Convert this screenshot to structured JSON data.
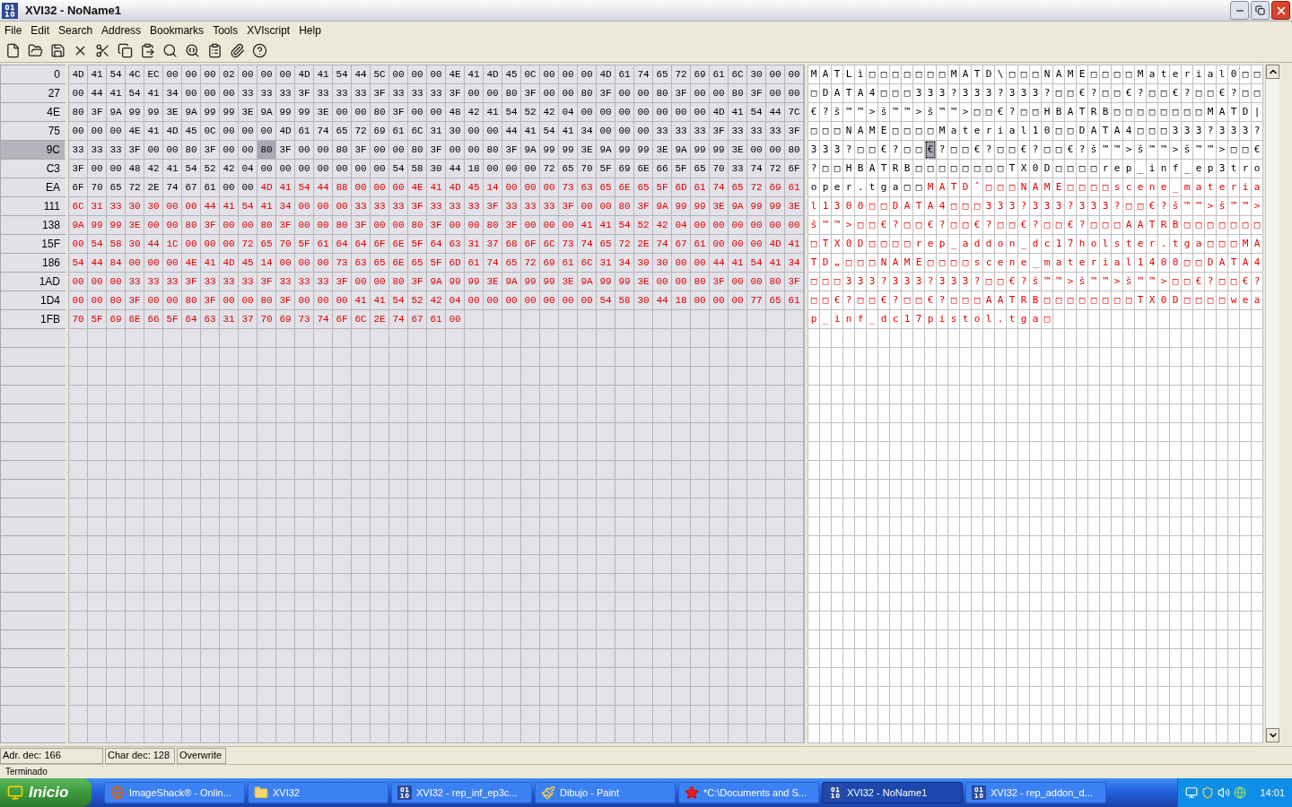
{
  "window": {
    "title": "XVI32 - NoName1"
  },
  "menu": [
    "File",
    "Edit",
    "Search",
    "Address",
    "Bookmarks",
    "Tools",
    "XVIscript",
    "Help"
  ],
  "rows": [
    {
      "address": "0",
      "selected": false,
      "hex": [
        "4D",
        "41",
        "54",
        "4C",
        "EC",
        "00",
        "00",
        "00",
        "02",
        "00",
        "00",
        "00",
        "4D",
        "41",
        "54",
        "44",
        "5C",
        "00",
        "00",
        "00",
        "4E",
        "41",
        "4D",
        "45",
        "0C",
        "00",
        "00",
        "00",
        "4D",
        "61",
        "74",
        "65",
        "72",
        "69",
        "61",
        "6C",
        "30",
        "00",
        "00"
      ],
      "chars": [
        "M",
        "A",
        "T",
        "L",
        "ì",
        "□",
        "□",
        "□",
        "□",
        "□",
        "□",
        "□",
        "M",
        "A",
        "T",
        "D",
        "\\",
        "□",
        "□",
        "□",
        "N",
        "A",
        "M",
        "E",
        "□",
        "□",
        "□",
        "□",
        "M",
        "a",
        "t",
        "e",
        "r",
        "i",
        "a",
        "l",
        "0",
        "□",
        "□"
      ],
      "modified": [
        false,
        false,
        false,
        false,
        false,
        false,
        false,
        false,
        false,
        false,
        false,
        false,
        false,
        false,
        false,
        false,
        false,
        false,
        false,
        false,
        false,
        false,
        false,
        false,
        false,
        false,
        false,
        false,
        false,
        false,
        false,
        false,
        false,
        false,
        false,
        false,
        false,
        false,
        false
      ],
      "cursor": [
        false,
        false,
        false,
        false,
        false,
        false,
        false,
        false,
        false,
        false,
        false,
        false,
        false,
        false,
        false,
        false,
        false,
        false,
        false,
        false,
        false,
        false,
        false,
        false,
        false,
        false,
        false,
        false,
        false,
        false,
        false,
        false,
        false,
        false,
        false,
        false,
        false,
        false,
        false
      ]
    },
    {
      "address": "27",
      "selected": false,
      "hex": [
        "00",
        "44",
        "41",
        "54",
        "41",
        "34",
        "00",
        "00",
        "00",
        "33",
        "33",
        "33",
        "3F",
        "33",
        "33",
        "33",
        "3F",
        "33",
        "33",
        "33",
        "3F",
        "00",
        "00",
        "80",
        "3F",
        "00",
        "00",
        "80",
        "3F",
        "00",
        "00",
        "80",
        "3F",
        "00",
        "00",
        "80",
        "3F",
        "00",
        "00"
      ],
      "chars": [
        "□",
        "D",
        "A",
        "T",
        "A",
        "4",
        "□",
        "□",
        "□",
        "3",
        "3",
        "3",
        "?",
        "3",
        "3",
        "3",
        "?",
        "3",
        "3",
        "3",
        "?",
        "□",
        "□",
        "€",
        "?",
        "□",
        "□",
        "€",
        "?",
        "□",
        "□",
        "€",
        "?",
        "□",
        "□",
        "€",
        "?",
        "□",
        "□"
      ],
      "modified": [
        false,
        false,
        false,
        false,
        false,
        false,
        false,
        false,
        false,
        false,
        false,
        false,
        false,
        false,
        false,
        false,
        false,
        false,
        false,
        false,
        false,
        false,
        false,
        false,
        false,
        false,
        false,
        false,
        false,
        false,
        false,
        false,
        false,
        false,
        false,
        false,
        false,
        false,
        false
      ],
      "cursor": [
        false,
        false,
        false,
        false,
        false,
        false,
        false,
        false,
        false,
        false,
        false,
        false,
        false,
        false,
        false,
        false,
        false,
        false,
        false,
        false,
        false,
        false,
        false,
        false,
        false,
        false,
        false,
        false,
        false,
        false,
        false,
        false,
        false,
        false,
        false,
        false,
        false,
        false,
        false
      ]
    },
    {
      "address": "4E",
      "selected": false,
      "hex": [
        "80",
        "3F",
        "9A",
        "99",
        "99",
        "3E",
        "9A",
        "99",
        "99",
        "3E",
        "9A",
        "99",
        "99",
        "3E",
        "00",
        "00",
        "80",
        "3F",
        "00",
        "00",
        "48",
        "42",
        "41",
        "54",
        "52",
        "42",
        "04",
        "00",
        "00",
        "00",
        "00",
        "00",
        "00",
        "00",
        "4D",
        "41",
        "54",
        "44",
        "7C"
      ],
      "chars": [
        "€",
        "?",
        "š",
        "™",
        "™",
        ">",
        "š",
        "™",
        "™",
        ">",
        "š",
        "™",
        "™",
        ">",
        "□",
        "□",
        "€",
        "?",
        "□",
        "□",
        "H",
        "B",
        "A",
        "T",
        "R",
        "B",
        "□",
        "□",
        "□",
        "□",
        "□",
        "□",
        "□",
        "□",
        "M",
        "A",
        "T",
        "D",
        "|"
      ],
      "modified": [
        false,
        false,
        false,
        false,
        false,
        false,
        false,
        false,
        false,
        false,
        false,
        false,
        false,
        false,
        false,
        false,
        false,
        false,
        false,
        false,
        false,
        false,
        false,
        false,
        false,
        false,
        false,
        false,
        false,
        false,
        false,
        false,
        false,
        false,
        false,
        false,
        false,
        false,
        false
      ],
      "cursor": [
        false,
        false,
        false,
        false,
        false,
        false,
        false,
        false,
        false,
        false,
        false,
        false,
        false,
        false,
        false,
        false,
        false,
        false,
        false,
        false,
        false,
        false,
        false,
        false,
        false,
        false,
        false,
        false,
        false,
        false,
        false,
        false,
        false,
        false,
        false,
        false,
        false,
        false,
        false
      ]
    },
    {
      "address": "75",
      "selected": false,
      "hex": [
        "00",
        "00",
        "00",
        "4E",
        "41",
        "4D",
        "45",
        "0C",
        "00",
        "00",
        "00",
        "4D",
        "61",
        "74",
        "65",
        "72",
        "69",
        "61",
        "6C",
        "31",
        "30",
        "00",
        "00",
        "44",
        "41",
        "54",
        "41",
        "34",
        "00",
        "00",
        "00",
        "33",
        "33",
        "33",
        "3F",
        "33",
        "33",
        "33",
        "3F"
      ],
      "chars": [
        "□",
        "□",
        "□",
        "N",
        "A",
        "M",
        "E",
        "□",
        "□",
        "□",
        "□",
        "M",
        "a",
        "t",
        "e",
        "r",
        "i",
        "a",
        "l",
        "1",
        "0",
        "□",
        "□",
        "D",
        "A",
        "T",
        "A",
        "4",
        "□",
        "□",
        "□",
        "3",
        "3",
        "3",
        "?",
        "3",
        "3",
        "3",
        "?"
      ],
      "modified": [
        false,
        false,
        false,
        false,
        false,
        false,
        false,
        false,
        false,
        false,
        false,
        false,
        false,
        false,
        false,
        false,
        false,
        false,
        false,
        false,
        false,
        false,
        false,
        false,
        false,
        false,
        false,
        false,
        false,
        false,
        false,
        false,
        false,
        false,
        false,
        false,
        false,
        false,
        false
      ],
      "cursor": [
        false,
        false,
        false,
        false,
        false,
        false,
        false,
        false,
        false,
        false,
        false,
        false,
        false,
        false,
        false,
        false,
        false,
        false,
        false,
        false,
        false,
        false,
        false,
        false,
        false,
        false,
        false,
        false,
        false,
        false,
        false,
        false,
        false,
        false,
        false,
        false,
        false,
        false,
        false
      ]
    },
    {
      "address": "9C",
      "selected": true,
      "hex": [
        "33",
        "33",
        "33",
        "3F",
        "00",
        "00",
        "80",
        "3F",
        "00",
        "00",
        "80",
        "3F",
        "00",
        "00",
        "80",
        "3F",
        "00",
        "00",
        "80",
        "3F",
        "00",
        "00",
        "80",
        "3F",
        "9A",
        "99",
        "99",
        "3E",
        "9A",
        "99",
        "99",
        "3E",
        "9A",
        "99",
        "99",
        "3E",
        "00",
        "00",
        "80"
      ],
      "chars": [
        "3",
        "3",
        "3",
        "?",
        "□",
        "□",
        "€",
        "?",
        "□",
        "□",
        "€",
        "?",
        "□",
        "□",
        "€",
        "?",
        "□",
        "□",
        "€",
        "?",
        "□",
        "□",
        "€",
        "?",
        "š",
        "™",
        "™",
        ">",
        "š",
        "™",
        "™",
        ">",
        "š",
        "™",
        "™",
        ">",
        "□",
        "□",
        "€"
      ],
      "modified": [
        false,
        false,
        false,
        false,
        false,
        false,
        false,
        false,
        false,
        false,
        false,
        false,
        false,
        false,
        false,
        false,
        false,
        false,
        false,
        false,
        false,
        false,
        false,
        false,
        false,
        false,
        false,
        false,
        false,
        false,
        false,
        false,
        false,
        false,
        false,
        false,
        false,
        false,
        false
      ],
      "cursor": [
        false,
        false,
        false,
        false,
        false,
        false,
        false,
        false,
        false,
        false,
        true,
        false,
        false,
        false,
        false,
        false,
        false,
        false,
        false,
        false,
        false,
        false,
        false,
        false,
        false,
        false,
        false,
        false,
        false,
        false,
        false,
        false,
        false,
        false,
        false,
        false,
        false,
        false,
        false
      ]
    },
    {
      "address": "C3",
      "selected": false,
      "hex": [
        "3F",
        "00",
        "00",
        "48",
        "42",
        "41",
        "54",
        "52",
        "42",
        "04",
        "00",
        "00",
        "00",
        "00",
        "00",
        "00",
        "00",
        "54",
        "58",
        "30",
        "44",
        "18",
        "00",
        "00",
        "00",
        "72",
        "65",
        "70",
        "5F",
        "69",
        "6E",
        "66",
        "5F",
        "65",
        "70",
        "33",
        "74",
        "72",
        "6F"
      ],
      "chars": [
        "?",
        "□",
        "□",
        "H",
        "B",
        "A",
        "T",
        "R",
        "B",
        "□",
        "□",
        "□",
        "□",
        "□",
        "□",
        "□",
        "□",
        "T",
        "X",
        "0",
        "D",
        "□",
        "□",
        "□",
        "□",
        "r",
        "e",
        "p",
        "_",
        "i",
        "n",
        "f",
        "_",
        "e",
        "p",
        "3",
        "t",
        "r",
        "o"
      ],
      "modified": [
        false,
        false,
        false,
        false,
        false,
        false,
        false,
        false,
        false,
        false,
        false,
        false,
        false,
        false,
        false,
        false,
        false,
        false,
        false,
        false,
        false,
        false,
        false,
        false,
        false,
        false,
        false,
        false,
        false,
        false,
        false,
        false,
        false,
        false,
        false,
        false,
        false,
        false,
        false
      ],
      "cursor": [
        false,
        false,
        false,
        false,
        false,
        false,
        false,
        false,
        false,
        false,
        false,
        false,
        false,
        false,
        false,
        false,
        false,
        false,
        false,
        false,
        false,
        false,
        false,
        false,
        false,
        false,
        false,
        false,
        false,
        false,
        false,
        false,
        false,
        false,
        false,
        false,
        false,
        false,
        false
      ]
    },
    {
      "address": "EA",
      "selected": false,
      "hex": [
        "6F",
        "70",
        "65",
        "72",
        "2E",
        "74",
        "67",
        "61",
        "00",
        "00",
        "4D",
        "41",
        "54",
        "44",
        "88",
        "00",
        "00",
        "00",
        "4E",
        "41",
        "4D",
        "45",
        "14",
        "00",
        "00",
        "00",
        "73",
        "63",
        "65",
        "6E",
        "65",
        "5F",
        "6D",
        "61",
        "74",
        "65",
        "72",
        "69",
        "61"
      ],
      "chars": [
        "o",
        "p",
        "e",
        "r",
        ".",
        "t",
        "g",
        "a",
        "□",
        "□",
        "M",
        "A",
        "T",
        "D",
        "ˆ",
        "□",
        "□",
        "□",
        "N",
        "A",
        "M",
        "E",
        "□",
        "□",
        "□",
        "□",
        "s",
        "c",
        "e",
        "n",
        "e",
        "_",
        "m",
        "a",
        "t",
        "e",
        "r",
        "i",
        "a"
      ],
      "modified": [
        false,
        false,
        false,
        false,
        false,
        false,
        false,
        false,
        false,
        false,
        true,
        true,
        true,
        true,
        true,
        true,
        true,
        true,
        true,
        true,
        true,
        true,
        true,
        true,
        true,
        true,
        true,
        true,
        true,
        true,
        true,
        true,
        true,
        true,
        true,
        true,
        true,
        true,
        true
      ],
      "cursor": [
        false,
        false,
        false,
        false,
        false,
        false,
        false,
        false,
        false,
        false,
        false,
        false,
        false,
        false,
        false,
        false,
        false,
        false,
        false,
        false,
        false,
        false,
        false,
        false,
        false,
        false,
        false,
        false,
        false,
        false,
        false,
        false,
        false,
        false,
        false,
        false,
        false,
        false,
        false
      ]
    },
    {
      "address": "111",
      "selected": false,
      "hex": [
        "6C",
        "31",
        "33",
        "30",
        "30",
        "00",
        "00",
        "44",
        "41",
        "54",
        "41",
        "34",
        "00",
        "00",
        "00",
        "33",
        "33",
        "33",
        "3F",
        "33",
        "33",
        "33",
        "3F",
        "33",
        "33",
        "33",
        "3F",
        "00",
        "00",
        "80",
        "3F",
        "9A",
        "99",
        "99",
        "3E",
        "9A",
        "99",
        "99",
        "3E"
      ],
      "chars": [
        "l",
        "1",
        "3",
        "0",
        "0",
        "□",
        "□",
        "D",
        "A",
        "T",
        "A",
        "4",
        "□",
        "□",
        "□",
        "3",
        "3",
        "3",
        "?",
        "3",
        "3",
        "3",
        "?",
        "3",
        "3",
        "3",
        "?",
        "□",
        "□",
        "€",
        "?",
        "š",
        "™",
        "™",
        ">",
        "š",
        "™",
        "™",
        ">"
      ],
      "modified": [
        true,
        true,
        true,
        true,
        true,
        true,
        true,
        true,
        true,
        true,
        true,
        true,
        true,
        true,
        true,
        true,
        true,
        true,
        true,
        true,
        true,
        true,
        true,
        true,
        true,
        true,
        true,
        true,
        true,
        true,
        true,
        true,
        true,
        true,
        true,
        true,
        true,
        true,
        true
      ],
      "cursor": [
        false,
        false,
        false,
        false,
        false,
        false,
        false,
        false,
        false,
        false,
        false,
        false,
        false,
        false,
        false,
        false,
        false,
        false,
        false,
        false,
        false,
        false,
        false,
        false,
        false,
        false,
        false,
        false,
        false,
        false,
        false,
        false,
        false,
        false,
        false,
        false,
        false,
        false,
        false
      ]
    },
    {
      "address": "138",
      "selected": false,
      "hex": [
        "9A",
        "99",
        "99",
        "3E",
        "00",
        "00",
        "80",
        "3F",
        "00",
        "00",
        "80",
        "3F",
        "00",
        "00",
        "80",
        "3F",
        "00",
        "00",
        "80",
        "3F",
        "00",
        "00",
        "80",
        "3F",
        "00",
        "00",
        "00",
        "41",
        "41",
        "54",
        "52",
        "42",
        "04",
        "00",
        "00",
        "00",
        "00",
        "00",
        "00"
      ],
      "chars": [
        "š",
        "™",
        "™",
        ">",
        "□",
        "□",
        "€",
        "?",
        "□",
        "□",
        "€",
        "?",
        "□",
        "□",
        "€",
        "?",
        "□",
        "□",
        "€",
        "?",
        "□",
        "□",
        "€",
        "?",
        "□",
        "□",
        "□",
        "A",
        "A",
        "T",
        "R",
        "B",
        "□",
        "□",
        "□",
        "□",
        "□",
        "□",
        "□"
      ],
      "modified": [
        true,
        true,
        true,
        true,
        true,
        true,
        true,
        true,
        true,
        true,
        true,
        true,
        true,
        true,
        true,
        true,
        true,
        true,
        true,
        true,
        true,
        true,
        true,
        true,
        true,
        true,
        true,
        true,
        true,
        true,
        true,
        true,
        true,
        true,
        true,
        true,
        true,
        true,
        true
      ],
      "cursor": [
        false,
        false,
        false,
        false,
        false,
        false,
        false,
        false,
        false,
        false,
        false,
        false,
        false,
        false,
        false,
        false,
        false,
        false,
        false,
        false,
        false,
        false,
        false,
        false,
        false,
        false,
        false,
        false,
        false,
        false,
        false,
        false,
        false,
        false,
        false,
        false,
        false,
        false,
        false
      ]
    },
    {
      "address": "15F",
      "selected": false,
      "hex": [
        "00",
        "54",
        "58",
        "30",
        "44",
        "1C",
        "00",
        "00",
        "00",
        "72",
        "65",
        "70",
        "5F",
        "61",
        "64",
        "64",
        "6F",
        "6E",
        "5F",
        "64",
        "63",
        "31",
        "37",
        "68",
        "6F",
        "6C",
        "73",
        "74",
        "65",
        "72",
        "2E",
        "74",
        "67",
        "61",
        "00",
        "00",
        "00",
        "4D",
        "41"
      ],
      "chars": [
        "□",
        "T",
        "X",
        "0",
        "D",
        "□",
        "□",
        "□",
        "□",
        "r",
        "e",
        "p",
        "_",
        "a",
        "d",
        "d",
        "o",
        "n",
        "_",
        "d",
        "c",
        "1",
        "7",
        "h",
        "o",
        "l",
        "s",
        "t",
        "e",
        "r",
        ".",
        "t",
        "g",
        "a",
        "□",
        "□",
        "□",
        "M",
        "A"
      ],
      "modified": [
        true,
        true,
        true,
        true,
        true,
        true,
        true,
        true,
        true,
        true,
        true,
        true,
        true,
        true,
        true,
        true,
        true,
        true,
        true,
        true,
        true,
        true,
        true,
        true,
        true,
        true,
        true,
        true,
        true,
        true,
        true,
        true,
        true,
        true,
        true,
        true,
        true,
        true,
        true
      ],
      "cursor": [
        false,
        false,
        false,
        false,
        false,
        false,
        false,
        false,
        false,
        false,
        false,
        false,
        false,
        false,
        false,
        false,
        false,
        false,
        false,
        false,
        false,
        false,
        false,
        false,
        false,
        false,
        false,
        false,
        false,
        false,
        false,
        false,
        false,
        false,
        false,
        false,
        false,
        false,
        false
      ]
    },
    {
      "address": "186",
      "selected": false,
      "hex": [
        "54",
        "44",
        "84",
        "00",
        "00",
        "00",
        "4E",
        "41",
        "4D",
        "45",
        "14",
        "00",
        "00",
        "00",
        "73",
        "63",
        "65",
        "6E",
        "65",
        "5F",
        "6D",
        "61",
        "74",
        "65",
        "72",
        "69",
        "61",
        "6C",
        "31",
        "34",
        "30",
        "30",
        "00",
        "00",
        "44",
        "41",
        "54",
        "41",
        "34"
      ],
      "chars": [
        "T",
        "D",
        "„",
        "□",
        "□",
        "□",
        "N",
        "A",
        "M",
        "E",
        "□",
        "□",
        "□",
        "□",
        "s",
        "c",
        "e",
        "n",
        "e",
        "_",
        "m",
        "a",
        "t",
        "e",
        "r",
        "i",
        "a",
        "l",
        "1",
        "4",
        "0",
        "0",
        "□",
        "□",
        "D",
        "A",
        "T",
        "A",
        "4"
      ],
      "modified": [
        true,
        true,
        true,
        true,
        true,
        true,
        true,
        true,
        true,
        true,
        true,
        true,
        true,
        true,
        true,
        true,
        true,
        true,
        true,
        true,
        true,
        true,
        true,
        true,
        true,
        true,
        true,
        true,
        true,
        true,
        true,
        true,
        true,
        true,
        true,
        true,
        true,
        true,
        true
      ],
      "cursor": [
        false,
        false,
        false,
        false,
        false,
        false,
        false,
        false,
        false,
        false,
        false,
        false,
        false,
        false,
        false,
        false,
        false,
        false,
        false,
        false,
        false,
        false,
        false,
        false,
        false,
        false,
        false,
        false,
        false,
        false,
        false,
        false,
        false,
        false,
        false,
        false,
        false,
        false,
        false
      ]
    },
    {
      "address": "1AD",
      "selected": false,
      "hex": [
        "00",
        "00",
        "00",
        "33",
        "33",
        "33",
        "3F",
        "33",
        "33",
        "33",
        "3F",
        "33",
        "33",
        "33",
        "3F",
        "00",
        "00",
        "80",
        "3F",
        "9A",
        "99",
        "99",
        "3E",
        "9A",
        "99",
        "99",
        "3E",
        "9A",
        "99",
        "99",
        "3E",
        "00",
        "00",
        "80",
        "3F",
        "00",
        "00",
        "80",
        "3F"
      ],
      "chars": [
        "□",
        "□",
        "□",
        "3",
        "3",
        "3",
        "?",
        "3",
        "3",
        "3",
        "?",
        "3",
        "3",
        "3",
        "?",
        "□",
        "□",
        "€",
        "?",
        "š",
        "™",
        "™",
        ">",
        "š",
        "™",
        "™",
        ">",
        "š",
        "™",
        "™",
        ">",
        "□",
        "□",
        "€",
        "?",
        "□",
        "□",
        "€",
        "?"
      ],
      "modified": [
        true,
        true,
        true,
        true,
        true,
        true,
        true,
        true,
        true,
        true,
        true,
        true,
        true,
        true,
        true,
        true,
        true,
        true,
        true,
        true,
        true,
        true,
        true,
        true,
        true,
        true,
        true,
        true,
        true,
        true,
        true,
        true,
        true,
        true,
        true,
        true,
        true,
        true,
        true
      ],
      "cursor": [
        false,
        false,
        false,
        false,
        false,
        false,
        false,
        false,
        false,
        false,
        false,
        false,
        false,
        false,
        false,
        false,
        false,
        false,
        false,
        false,
        false,
        false,
        false,
        false,
        false,
        false,
        false,
        false,
        false,
        false,
        false,
        false,
        false,
        false,
        false,
        false,
        false,
        false,
        false
      ]
    },
    {
      "address": "1D4",
      "selected": false,
      "hex": [
        "00",
        "00",
        "80",
        "3F",
        "00",
        "00",
        "80",
        "3F",
        "00",
        "00",
        "80",
        "3F",
        "00",
        "00",
        "00",
        "41",
        "41",
        "54",
        "52",
        "42",
        "04",
        "00",
        "00",
        "00",
        "00",
        "00",
        "00",
        "00",
        "54",
        "58",
        "30",
        "44",
        "18",
        "00",
        "00",
        "00",
        "77",
        "65",
        "61"
      ],
      "chars": [
        "□",
        "□",
        "€",
        "?",
        "□",
        "□",
        "€",
        "?",
        "□",
        "□",
        "€",
        "?",
        "□",
        "□",
        "□",
        "A",
        "A",
        "T",
        "R",
        "B",
        "□",
        "□",
        "□",
        "□",
        "□",
        "□",
        "□",
        "□",
        "T",
        "X",
        "0",
        "D",
        "□",
        "□",
        "□",
        "□",
        "w",
        "e",
        "a"
      ],
      "modified": [
        true,
        true,
        true,
        true,
        true,
        true,
        true,
        true,
        true,
        true,
        true,
        true,
        true,
        true,
        true,
        true,
        true,
        true,
        true,
        true,
        true,
        true,
        true,
        true,
        true,
        true,
        true,
        true,
        true,
        true,
        true,
        true,
        true,
        true,
        true,
        true,
        true,
        true,
        true
      ],
      "cursor": [
        false,
        false,
        false,
        false,
        false,
        false,
        false,
        false,
        false,
        false,
        false,
        false,
        false,
        false,
        false,
        false,
        false,
        false,
        false,
        false,
        false,
        false,
        false,
        false,
        false,
        false,
        false,
        false,
        false,
        false,
        false,
        false,
        false,
        false,
        false,
        false,
        false,
        false,
        false
      ]
    },
    {
      "address": "1FB",
      "selected": false,
      "hex": [
        "70",
        "5F",
        "69",
        "6E",
        "66",
        "5F",
        "64",
        "63",
        "31",
        "37",
        "70",
        "69",
        "73",
        "74",
        "6F",
        "6C",
        "2E",
        "74",
        "67",
        "61",
        "00"
      ],
      "chars": [
        "p",
        "_",
        "i",
        "n",
        "f",
        "_",
        "d",
        "c",
        "1",
        "7",
        "p",
        "i",
        "s",
        "t",
        "o",
        "l",
        ".",
        "t",
        "g",
        "a",
        "□"
      ],
      "modified": [
        true,
        true,
        true,
        true,
        true,
        true,
        true,
        true,
        true,
        true,
        true,
        true,
        true,
        true,
        true,
        true,
        true,
        true,
        true,
        true,
        true
      ],
      "cursor": [
        false,
        false,
        false,
        false,
        false,
        false,
        false,
        false,
        false,
        false,
        false,
        false,
        false,
        false,
        false,
        false,
        false,
        false,
        false,
        false,
        false
      ]
    }
  ],
  "status_bar": [
    "Adr. dec: 166",
    "Char dec: 128",
    "Overwrite"
  ],
  "background_status": "Terminado",
  "taskbar": {
    "start": "Inicio",
    "clock": "14:01",
    "tasks": [
      {
        "label": "ImageShack® - Onlin...",
        "kind": "browser",
        "selected": false
      },
      {
        "label": "XVI32",
        "kind": "folder",
        "selected": false
      },
      {
        "label": "XVI32 - rep_inf_ep3c...",
        "kind": "hex-editor",
        "selected": false
      },
      {
        "label": "Dibujo - Paint",
        "kind": "paint",
        "selected": false
      },
      {
        "label": "*C:\\Documents and S...",
        "kind": "document",
        "selected": false
      },
      {
        "label": "XVI32 - NoName1",
        "kind": "hex-editor",
        "selected": true
      },
      {
        "label": "XVI32 - rep_addon_d...",
        "kind": "hex-editor",
        "selected": false
      }
    ]
  }
}
